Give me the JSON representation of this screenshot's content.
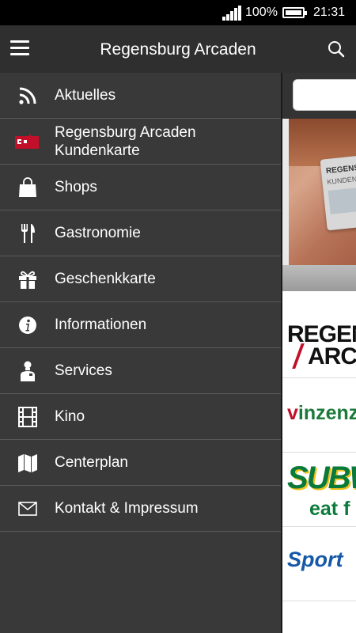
{
  "status_bar": {
    "battery_percent": "100%",
    "time": "21:31"
  },
  "app_bar": {
    "title": "Regensburg Arcaden"
  },
  "drawer": {
    "items": [
      {
        "label": "Aktuelles",
        "icon": "rss-icon"
      },
      {
        "label": "Regensburg Arcaden\nKundenkarte",
        "icon": "customer-card-icon"
      },
      {
        "label": "Shops",
        "icon": "shopping-bag-icon"
      },
      {
        "label": "Gastronomie",
        "icon": "fork-knife-icon"
      },
      {
        "label": "Geschenkkarte",
        "icon": "gift-icon"
      },
      {
        "label": "Informationen",
        "icon": "info-icon"
      },
      {
        "label": "Services",
        "icon": "service-person-icon"
      },
      {
        "label": "Kino",
        "icon": "film-icon"
      },
      {
        "label": "Centerplan",
        "icon": "map-icon"
      },
      {
        "label": "Kontakt & Impressum",
        "icon": "envelope-icon"
      }
    ]
  },
  "content": {
    "banner": {
      "card_line1": "REGENSBUR",
      "card_line2": "KUNDENKART"
    },
    "logos": {
      "regensburg_line1": "REGENS",
      "regensburg_line2": "ARCA",
      "vinzenz_v": "v",
      "vinzenz_rest": "inzenz",
      "subway": "SUBW",
      "subway_tagline": "eat f",
      "sport": "Sport"
    }
  },
  "colors": {
    "drawer_bg": "#393939",
    "appbar_bg": "#2f2f2f",
    "accent_red": "#c2102a"
  }
}
